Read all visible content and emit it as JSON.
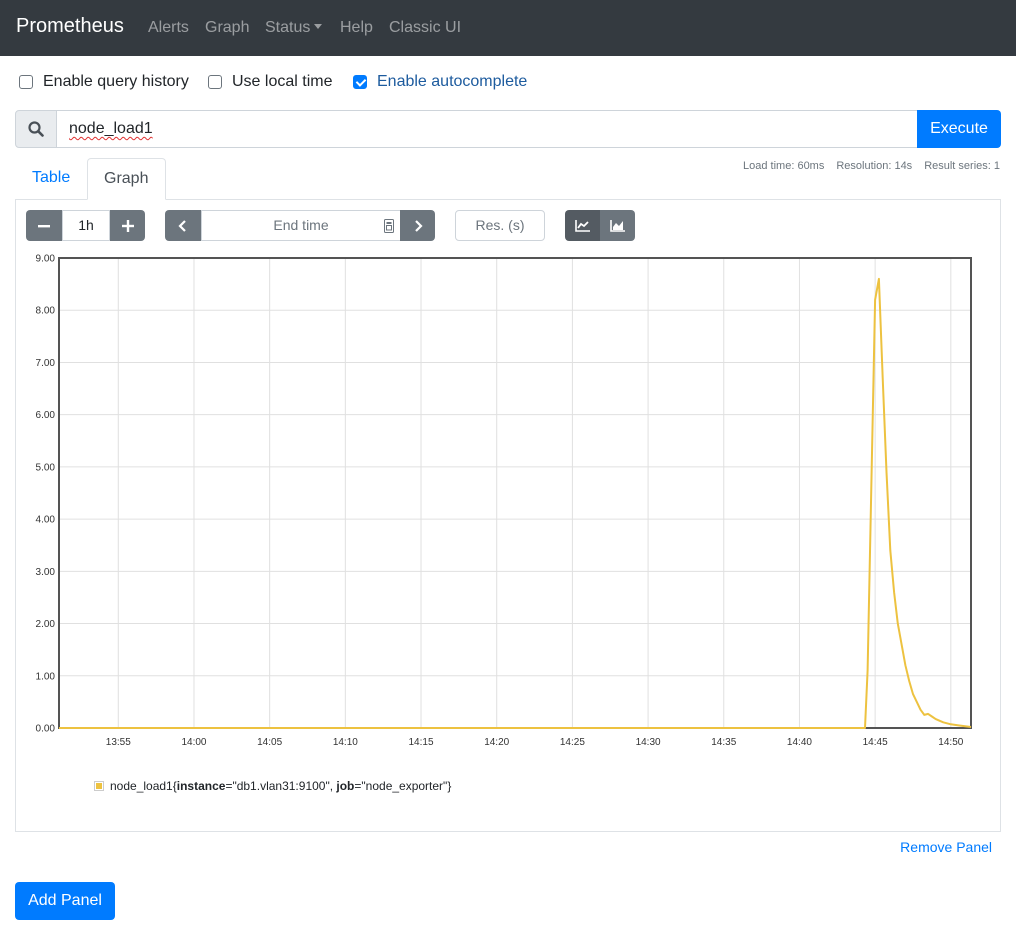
{
  "navbar": {
    "brand": "Prometheus",
    "items": [
      {
        "label": "Alerts"
      },
      {
        "label": "Graph"
      },
      {
        "label": "Status"
      },
      {
        "label": "Help"
      },
      {
        "label": "Classic UI"
      }
    ]
  },
  "options": {
    "query_history": {
      "label": "Enable query history",
      "checked": false
    },
    "local_time": {
      "label": "Use local time",
      "checked": false
    },
    "autocomplete": {
      "label": "Enable autocomplete",
      "checked": true
    }
  },
  "query": {
    "value": "node_load1",
    "execute_label": "Execute",
    "search_icon": "search-icon"
  },
  "stats": {
    "load_time": "Load time: 60ms",
    "resolution": "Resolution: 14s",
    "result_series": "Result series: 1"
  },
  "tabs": [
    {
      "label": "Table",
      "active": false
    },
    {
      "label": "Graph",
      "active": true
    }
  ],
  "graph_controls": {
    "range_value": "1h",
    "end_time_placeholder": "End time",
    "resolution_placeholder": "Res. (s)",
    "icons": [
      "minus-icon",
      "plus-icon",
      "chevron-left-icon",
      "calendar-icon",
      "chevron-right-icon",
      "line-chart-icon",
      "area-chart-icon"
    ]
  },
  "chart_data": {
    "type": "line",
    "title": "",
    "xlabel": "",
    "ylabel": "",
    "x_ticks": [
      "13:55",
      "14:00",
      "14:05",
      "14:10",
      "14:15",
      "14:20",
      "14:25",
      "14:30",
      "14:35",
      "14:40",
      "14:45",
      "14:50"
    ],
    "y_ticks": [
      "0.00",
      "1.00",
      "2.00",
      "3.00",
      "4.00",
      "5.00",
      "6.00",
      "7.00",
      "8.00",
      "9.00"
    ],
    "ylim": [
      0,
      9
    ],
    "xlim": [
      "13:51:05",
      "14:51:20"
    ],
    "grid": true,
    "series": [
      {
        "name": "node_load1{instance=\"db1.vlan31:9100\", job=\"node_exporter\"}",
        "color": "#edc240",
        "x": [
          "13:51:05",
          "14:44:20",
          "14:44:30",
          "14:44:45",
          "14:45:00",
          "14:45:15",
          "14:45:30",
          "14:45:45",
          "14:46:00",
          "14:46:15",
          "14:46:30",
          "14:46:45",
          "14:47:00",
          "14:47:15",
          "14:47:30",
          "14:47:45",
          "14:48:00",
          "14:48:15",
          "14:48:30",
          "14:48:45",
          "14:49:00",
          "14:49:30",
          "14:50:00",
          "14:50:30",
          "14:51:20"
        ],
        "values": [
          0.0,
          0.0,
          1.1,
          4.6,
          8.2,
          8.6,
          6.7,
          4.9,
          3.4,
          2.6,
          2.0,
          1.6,
          1.2,
          0.9,
          0.65,
          0.5,
          0.35,
          0.25,
          0.27,
          0.22,
          0.17,
          0.11,
          0.07,
          0.05,
          0.02
        ]
      }
    ],
    "legend": {
      "metric": "node_load1",
      "labels": [
        {
          "key": "instance",
          "value": "\"db1.vlan31:9100\""
        },
        {
          "key": "job",
          "value": "\"node_exporter\""
        }
      ],
      "position": "bottom-left"
    }
  },
  "panel": {
    "remove_label": "Remove Panel",
    "add_label": "Add Panel"
  }
}
